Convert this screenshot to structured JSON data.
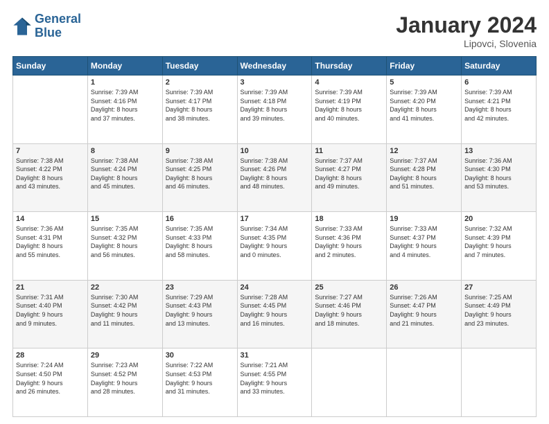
{
  "header": {
    "logo_line1": "General",
    "logo_line2": "Blue",
    "main_title": "January 2024",
    "subtitle": "Lipovci, Slovenia"
  },
  "weekdays": [
    "Sunday",
    "Monday",
    "Tuesday",
    "Wednesday",
    "Thursday",
    "Friday",
    "Saturday"
  ],
  "weeks": [
    [
      {
        "day": "",
        "sunrise": "",
        "sunset": "",
        "daylight": ""
      },
      {
        "day": "1",
        "sunrise": "Sunrise: 7:39 AM",
        "sunset": "Sunset: 4:16 PM",
        "daylight": "Daylight: 8 hours and 37 minutes."
      },
      {
        "day": "2",
        "sunrise": "Sunrise: 7:39 AM",
        "sunset": "Sunset: 4:17 PM",
        "daylight": "Daylight: 8 hours and 38 minutes."
      },
      {
        "day": "3",
        "sunrise": "Sunrise: 7:39 AM",
        "sunset": "Sunset: 4:18 PM",
        "daylight": "Daylight: 8 hours and 39 minutes."
      },
      {
        "day": "4",
        "sunrise": "Sunrise: 7:39 AM",
        "sunset": "Sunset: 4:19 PM",
        "daylight": "Daylight: 8 hours and 40 minutes."
      },
      {
        "day": "5",
        "sunrise": "Sunrise: 7:39 AM",
        "sunset": "Sunset: 4:20 PM",
        "daylight": "Daylight: 8 hours and 41 minutes."
      },
      {
        "day": "6",
        "sunrise": "Sunrise: 7:39 AM",
        "sunset": "Sunset: 4:21 PM",
        "daylight": "Daylight: 8 hours and 42 minutes."
      }
    ],
    [
      {
        "day": "7",
        "sunrise": "Sunrise: 7:38 AM",
        "sunset": "Sunset: 4:22 PM",
        "daylight": "Daylight: 8 hours and 43 minutes."
      },
      {
        "day": "8",
        "sunrise": "Sunrise: 7:38 AM",
        "sunset": "Sunset: 4:24 PM",
        "daylight": "Daylight: 8 hours and 45 minutes."
      },
      {
        "day": "9",
        "sunrise": "Sunrise: 7:38 AM",
        "sunset": "Sunset: 4:25 PM",
        "daylight": "Daylight: 8 hours and 46 minutes."
      },
      {
        "day": "10",
        "sunrise": "Sunrise: 7:38 AM",
        "sunset": "Sunset: 4:26 PM",
        "daylight": "Daylight: 8 hours and 48 minutes."
      },
      {
        "day": "11",
        "sunrise": "Sunrise: 7:37 AM",
        "sunset": "Sunset: 4:27 PM",
        "daylight": "Daylight: 8 hours and 49 minutes."
      },
      {
        "day": "12",
        "sunrise": "Sunrise: 7:37 AM",
        "sunset": "Sunset: 4:28 PM",
        "daylight": "Daylight: 8 hours and 51 minutes."
      },
      {
        "day": "13",
        "sunrise": "Sunrise: 7:36 AM",
        "sunset": "Sunset: 4:30 PM",
        "daylight": "Daylight: 8 hours and 53 minutes."
      }
    ],
    [
      {
        "day": "14",
        "sunrise": "Sunrise: 7:36 AM",
        "sunset": "Sunset: 4:31 PM",
        "daylight": "Daylight: 8 hours and 55 minutes."
      },
      {
        "day": "15",
        "sunrise": "Sunrise: 7:35 AM",
        "sunset": "Sunset: 4:32 PM",
        "daylight": "Daylight: 8 hours and 56 minutes."
      },
      {
        "day": "16",
        "sunrise": "Sunrise: 7:35 AM",
        "sunset": "Sunset: 4:33 PM",
        "daylight": "Daylight: 8 hours and 58 minutes."
      },
      {
        "day": "17",
        "sunrise": "Sunrise: 7:34 AM",
        "sunset": "Sunset: 4:35 PM",
        "daylight": "Daylight: 9 hours and 0 minutes."
      },
      {
        "day": "18",
        "sunrise": "Sunrise: 7:33 AM",
        "sunset": "Sunset: 4:36 PM",
        "daylight": "Daylight: 9 hours and 2 minutes."
      },
      {
        "day": "19",
        "sunrise": "Sunrise: 7:33 AM",
        "sunset": "Sunset: 4:37 PM",
        "daylight": "Daylight: 9 hours and 4 minutes."
      },
      {
        "day": "20",
        "sunrise": "Sunrise: 7:32 AM",
        "sunset": "Sunset: 4:39 PM",
        "daylight": "Daylight: 9 hours and 7 minutes."
      }
    ],
    [
      {
        "day": "21",
        "sunrise": "Sunrise: 7:31 AM",
        "sunset": "Sunset: 4:40 PM",
        "daylight": "Daylight: 9 hours and 9 minutes."
      },
      {
        "day": "22",
        "sunrise": "Sunrise: 7:30 AM",
        "sunset": "Sunset: 4:42 PM",
        "daylight": "Daylight: 9 hours and 11 minutes."
      },
      {
        "day": "23",
        "sunrise": "Sunrise: 7:29 AM",
        "sunset": "Sunset: 4:43 PM",
        "daylight": "Daylight: 9 hours and 13 minutes."
      },
      {
        "day": "24",
        "sunrise": "Sunrise: 7:28 AM",
        "sunset": "Sunset: 4:45 PM",
        "daylight": "Daylight: 9 hours and 16 minutes."
      },
      {
        "day": "25",
        "sunrise": "Sunrise: 7:27 AM",
        "sunset": "Sunset: 4:46 PM",
        "daylight": "Daylight: 9 hours and 18 minutes."
      },
      {
        "day": "26",
        "sunrise": "Sunrise: 7:26 AM",
        "sunset": "Sunset: 4:47 PM",
        "daylight": "Daylight: 9 hours and 21 minutes."
      },
      {
        "day": "27",
        "sunrise": "Sunrise: 7:25 AM",
        "sunset": "Sunset: 4:49 PM",
        "daylight": "Daylight: 9 hours and 23 minutes."
      }
    ],
    [
      {
        "day": "28",
        "sunrise": "Sunrise: 7:24 AM",
        "sunset": "Sunset: 4:50 PM",
        "daylight": "Daylight: 9 hours and 26 minutes."
      },
      {
        "day": "29",
        "sunrise": "Sunrise: 7:23 AM",
        "sunset": "Sunset: 4:52 PM",
        "daylight": "Daylight: 9 hours and 28 minutes."
      },
      {
        "day": "30",
        "sunrise": "Sunrise: 7:22 AM",
        "sunset": "Sunset: 4:53 PM",
        "daylight": "Daylight: 9 hours and 31 minutes."
      },
      {
        "day": "31",
        "sunrise": "Sunrise: 7:21 AM",
        "sunset": "Sunset: 4:55 PM",
        "daylight": "Daylight: 9 hours and 33 minutes."
      },
      {
        "day": "",
        "sunrise": "",
        "sunset": "",
        "daylight": ""
      },
      {
        "day": "",
        "sunrise": "",
        "sunset": "",
        "daylight": ""
      },
      {
        "day": "",
        "sunrise": "",
        "sunset": "",
        "daylight": ""
      }
    ]
  ]
}
